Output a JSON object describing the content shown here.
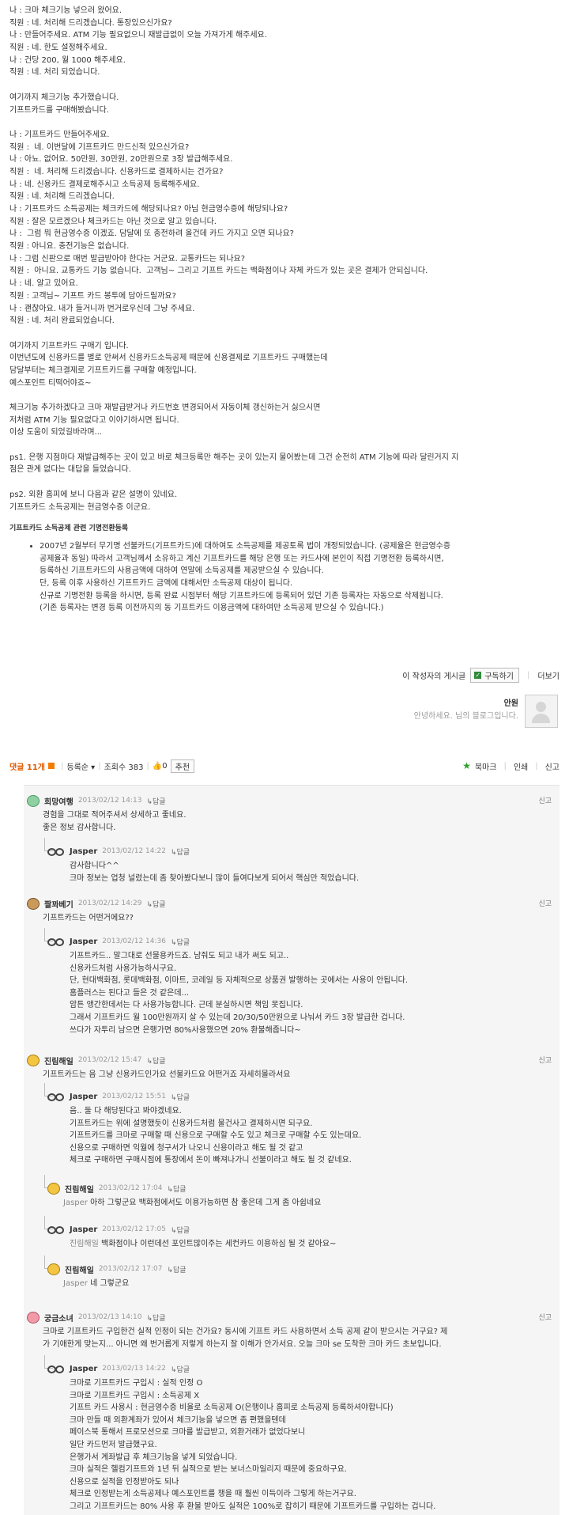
{
  "post": {
    "lines": [
      "나 : 크마 체크기능 넣으러 왔어요.",
      "직원 : 네. 처리해 드리겠습니다. 통장있으신가요?",
      "나 : 만들어주세요. ATM 기능 필요없으니 재발급없이 오늘 가져가게 해주세요.",
      "직원 : 네. 한도 설정해주세요.",
      "나 : 건당 200, 월 1000 해주세요.",
      "직원 : 네. 처리 되었습니다.",
      "",
      "여기까지 체크기능 추가했습니다.",
      "기프트카드를 구매해봤습니다.",
      "",
      "나 : 기프트카드 만들어주세요.",
      "직원 :  네. 이번달에 기프트카드 만드신적 있으신가요?",
      "나 : 아뇨. 없어요. 50만원, 30만원, 20만원으로 3장 발급해주세요.",
      "직원 :  네. 처리해 드리겠습니다. 신용카드로 결제하시는 건가요?",
      "나 : 네. 신용카드 결제로해주시고 소득공제 등록해주세요.",
      "직원 : 네. 처리해 드리겠습니다.",
      "나 : 기프트카드 소득공제는 체크카드에 해당되나요? 아님 현금영수증에 해당되나요?",
      "직원 : 잘은 모르겠으나 체크카드는 아닌 것으로 알고 있습니다.",
      "나 :  그럼 뭐 현금영수증 이겠죠. 담달에 또 충전하려 올건데 카드 가지고 오면 되나요?",
      "직원 : 아니요. 충전기능은 없습니다.",
      "나 : 그럼 신판으로 매번 발급받아야 한다는 거군요. 교통카드는 되나요?",
      "직원 :  아니요. 교통카드 기능 없습니다.  고객님~ 그리고 기프트 카드는 백화점이나 자체 카드가 있는 곳은 결제가 안되십니다.",
      "나 : 네. 알고 있어요.",
      "직원 : 고객님~ 기프트 카드 봉투에 담아드릴까요?",
      "나 : 괜찮아요. 내가 들거니까 번거로우신데 그냥 주세요.",
      "직원 : 네. 처리 완료되었습니다.",
      "",
      "여기까지 기프트카드 구매기 입니다.",
      "이번년도에 신용카드를 별로 안써서 신용카드소득공제 때문에 신용결제로 기프트카드 구매했는데",
      "담달부터는 체크결제로 기프트카드를 구매할 예정입니다.",
      "예스포인트 티떡어야죠~",
      "",
      "체크기능 추가하겠다고 크마 재발급받거나 카드번호 변경되어서 자동이체 갱신하는거 싫으시면",
      "저처럼 ATM 기능 필요없다고 이야기하시면 됩니다.",
      "이상 도움이 되었길바라며...",
      "",
      "ps1. 은행 지점마다 재발급해주는 곳이 있고 바로 체크등록만 해주는 곳이 있는지 물어봤는데 그건 순전히 ATM 기능에 따라 달린거지 지",
      "점은 관계 없다는 대답을 들었습니다.",
      "",
      "ps2. 외환 홈피에 보니 다음과 같은 설명이 있네요.",
      "기프트카드 소득공제는 현금영수증 이군요."
    ],
    "notice_title": "기프트카드 소득공제 관련 기명전환등록",
    "notice_lines": [
      "2007년 2월부터 무기명 선불카드(기프트카드)에 대하여도 소득공제를 제공토록 법이 개정되었습니다. (공제율은 현금영수증",
      "공제율과 동일) 따라서 고객님께서 소유하고 계신 기프트카드를 해당 은행 또는 카드사에 본인이 직접 기명전환 등록하시면,",
      "등록하신 기프트카드의 사용금액에 대하여 연말에 소득공제를 제공받으실 수 있습니다.",
      "단, 등록 이후 사용하신 기프트카드 금액에 대해서만 소득공제 대상이 됩니다.",
      "신규로 기명전환 등록을 하시면, 등록 완료 시점부터 해당 기프트카드에 등록되어 있던 기존 등록자는 자동으로 삭제됩니다.",
      "(기존 등록자는 변경 등록 이전까지의 동 기프트카드 이용금액에 대하여만 소득공제 받으실 수 있습니다.)"
    ]
  },
  "author_bar": {
    "posts_link": "이 작성자의 게시글",
    "subscribe": "구독하기",
    "more": "더보기"
  },
  "author": {
    "name": "안원",
    "desc": "안녕하세요. 님의 블로그입니다."
  },
  "comment_bar": {
    "count": "댓글 11개",
    "sort": "등록순",
    "views": "조회수 383",
    "likes": "0",
    "recommend": "추천",
    "bookmark": "북마크",
    "print": "인쇄",
    "report": "신고"
  },
  "comments": [
    {
      "nick": "희망여행",
      "date": "2013/02/12 14:13",
      "reply": "↳답글",
      "report": "신고",
      "body": "경험을 그대로 적어주셔서 상세하고 좋네요.\n좋은 정보 감사합니다."
    },
    {
      "nick": "Jasper",
      "date": "2013/02/12 14:22",
      "reply": "↳답글",
      "body": "감사합니다^^\n크마 정보는 업청 널렸는데 좀 찾아봤다보니 많이 들여다보게 되어서 핵심만 적었습니다."
    },
    {
      "nick": "짤꽈베기",
      "date": "2013/02/12 14:29",
      "reply": "↳답글",
      "report": "신고",
      "body": "기프트카드는 어떤거에요??"
    },
    {
      "nick": "Jasper",
      "date": "2013/02/12 14:36",
      "reply": "↳답글",
      "body": "기프트카드.. 말그대로 선물용카드죠. 남줘도 되고 내가 써도 되고..\n신용카드처럼 사용가능하시구요.\n단, 현대백화점, 롯데백화점, 이마트, 코레일 등 자체적으로 상품권 발행하는 곳에서는 사용이 안됩니다.\n홈플러스는 된다고 들은 것 같은데...\n암튼 앵간한데서는 다 사용가능합니다. 근데 분실하시면 책임 못집니다.\n그래서 기프트카드 월 100만원까지 살 수 있는데 20/30/50만원으로 나눠서 카드 3장 발급한 겁니다.\n쓰다가 자투리 남으면 은행가면 80%사용했으면 20% 환불해줍니다~"
    },
    {
      "nick": "진림해일",
      "date": "2013/02/12 15:47",
      "reply": "↳답글",
      "report": "신고",
      "body": "기프트카드는 음 그냥 신용카드인가요 선불카드요 어떤거죠 자세히몰라서요"
    },
    {
      "nick": "Jasper",
      "date": "2013/02/12 15:51",
      "reply": "↳답글",
      "body": "음.. 둘 다 해당된다고 봐야겠네요.\n기프트카드는 위에 설명했듯이 신용카드처럼 물건사고 결제하시면 되구요.\n기프트카드를 크마로 구매할 때 신용으로 구매할 수도 있고 체크로 구매할 수도 있는데요.\n신용으로 구매하면 익월에 청구서가 나오니 신용이라고 해도 될 것 같고\n체크로 구매하면 구매시점에 통장에서 돈이 빠져나가니 선불이라고 해도 될 것 같네요."
    },
    {
      "nick": "진림해일",
      "date": "2013/02/12 17:04",
      "reply": "↳답글",
      "mention": "Jasper",
      "body": "아하 그렇군요 백화점에서도 이용가능하면 참 좋은데 그게 좀 아쉽네요"
    },
    {
      "nick": "Jasper",
      "date": "2013/02/12 17:05",
      "reply": "↳답글",
      "mention": "진림해일",
      "body": "백화점이나 이런데선 포인트많이주는 세컨카드 이용하심 될 것 같아요~"
    },
    {
      "nick": "진림해일",
      "date": "2013/02/12 17:07",
      "reply": "↳답글",
      "mention": "Jasper",
      "body": "네 그렇군요"
    },
    {
      "nick": "궁금소녀",
      "date": "2013/02/13 14:10",
      "reply": "↳답글",
      "report": "신고",
      "body": "크마로 기프트카드 구입한건 실적 인정이 되는 건가요? 동시에 기프트 카드 사용하면서 소득 공제 같이 받으시는 거구요? 제\n가 기애한게 맞는지... 아니면 왜 번거롭게 저렇게 하는지 잘 이해가 안가서요. 오늘 크마 se 도착한 크마 카드 초보입니다."
    },
    {
      "nick": "Jasper",
      "date": "2013/02/13 14:22",
      "reply": "↳답글",
      "body": "크마로 기프트카드 구입시 : 실적 인정 O\n크마로 기프트카드 구입시 : 소득공제 X\n기프트 카드 사용시 : 현금영수증 비율로 소득공제 O(은행이나 홈피로 소득공제 등록하셔야합니다)\n크마 만들 때 외환계좌가 있어서 체크기능을 넣으면 좀 편했을텐데\n페이스북 통해서 프로모션으로 크마를 발급받고, 외환거래가 없었다보니\n일단 카드먼저 발급했구요.\n은행가서 계좌발급 후 체크기능을 넣게 되었습니다.\n크마 실적은 헬컴기프트와 1년 뒤 실적으로 받는 보너스마일리지 때문에 중요하구요.\n신용으로 실적을 인정받아도 되나\n체크로 인정받는게 소득공제나 예스포인트를 챙을 때 훨씬 이득이라 그렇게 하는거구요.\n그리고 기프트카드는 80% 사용 후 환불 받아도 실적은 100%로 잡히기 때문에 기프트카드를 구입하는 겁니다."
    }
  ]
}
